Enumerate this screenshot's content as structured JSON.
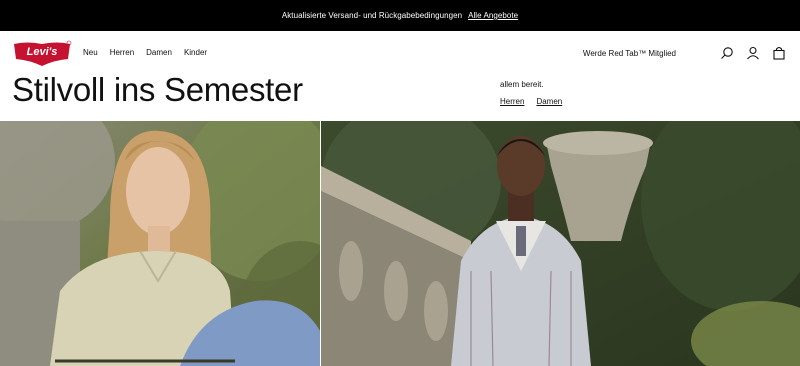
{
  "promo": {
    "text": "Aktualisierte Versand- und Rückgabebedingungen",
    "link": "Alle Angebote"
  },
  "brand": {
    "logo_text": "Levi's",
    "logo_color": "#c41230"
  },
  "nav": {
    "items": [
      "Neu",
      "Herren",
      "Damen",
      "Kinder"
    ]
  },
  "header": {
    "member_link": "Werde Red Tab™ Mitglied",
    "icons": [
      "search-icon",
      "account-icon",
      "bag-icon"
    ]
  },
  "hero": {
    "title": "Stilvoll ins Semester",
    "description": "allem bereit.",
    "links": [
      "Herren",
      "Damen"
    ]
  },
  "colors": {
    "promo_bg": "#000000",
    "accent": "#c41230"
  }
}
